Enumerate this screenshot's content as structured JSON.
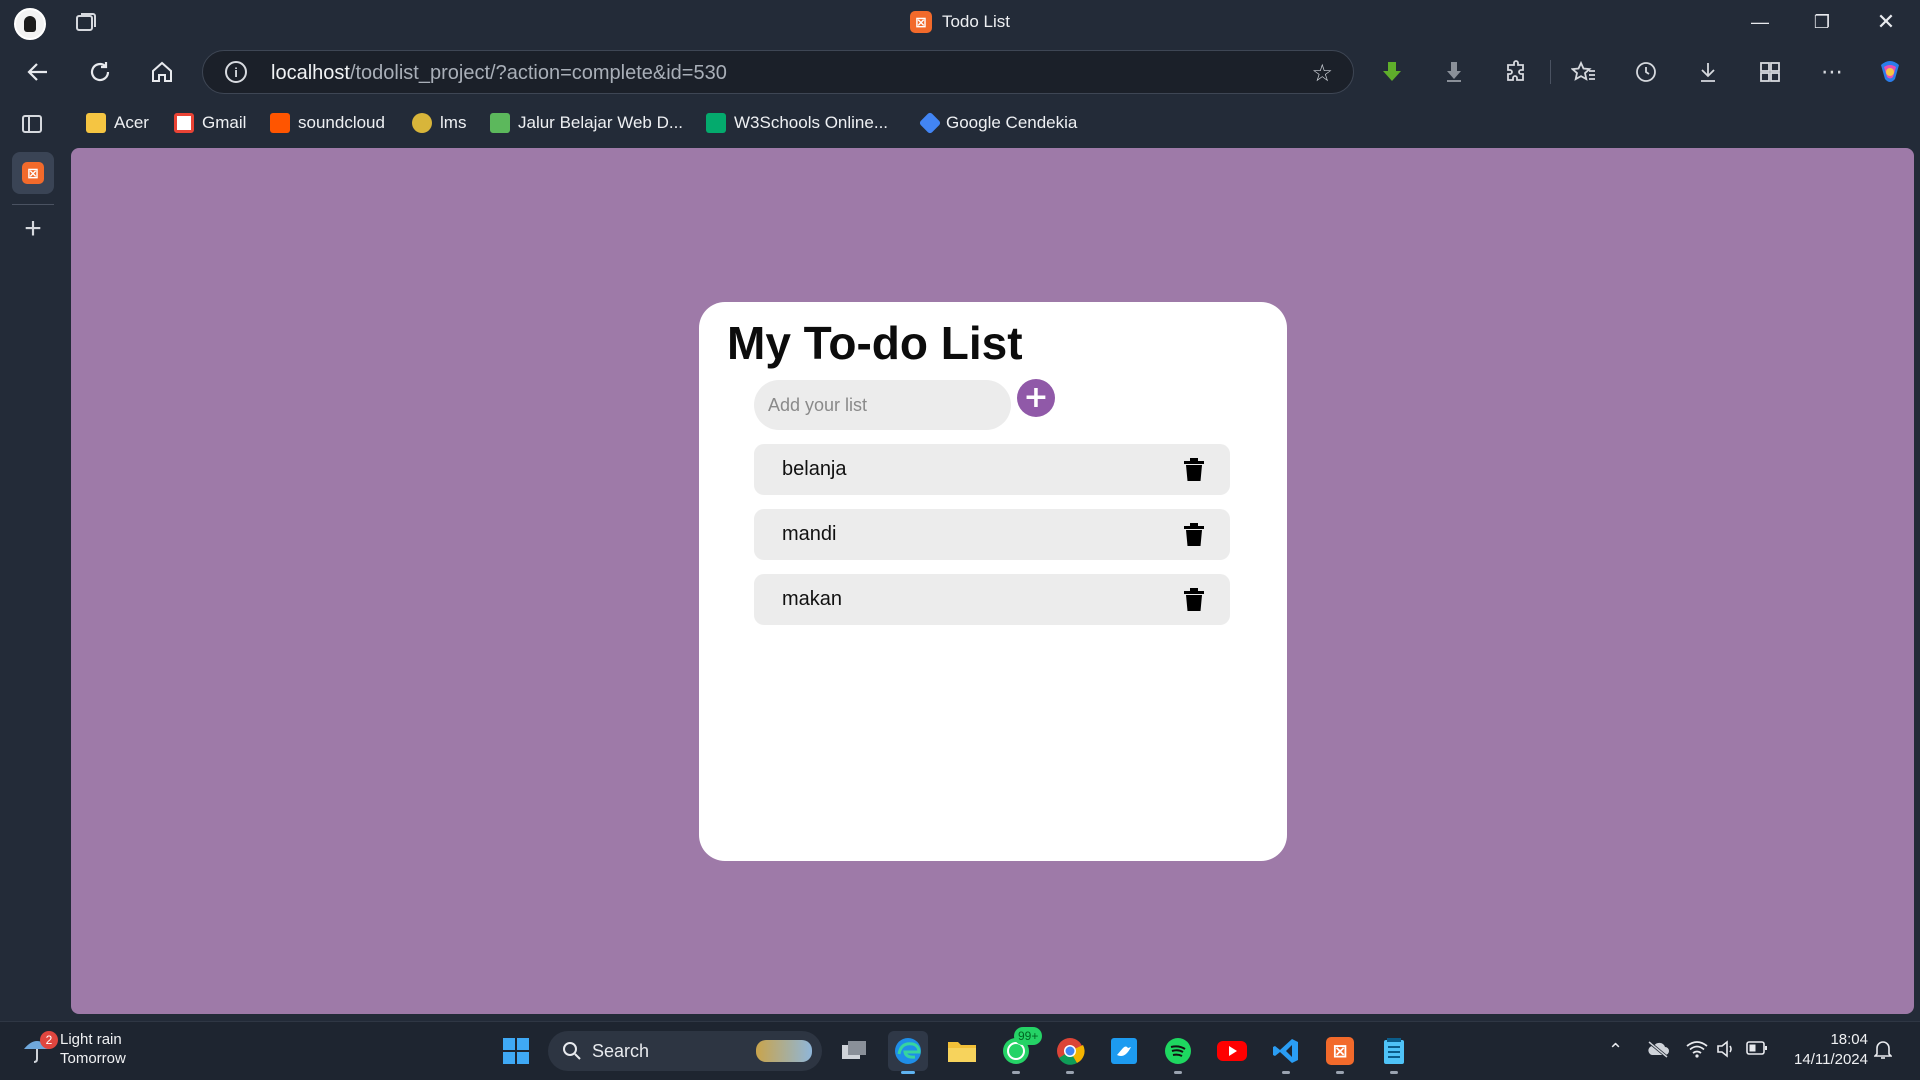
{
  "window": {
    "title": "Todo List"
  },
  "address": {
    "host": "localhost",
    "path": "/todolist_project/?action=complete&id=530"
  },
  "bookmarks": [
    {
      "label": "Acer",
      "icon": "folder-icon",
      "color": "#f5c542"
    },
    {
      "label": "Gmail",
      "icon": "gmail-icon",
      "color": "#ea4335"
    },
    {
      "label": "soundcloud",
      "icon": "soundcloud-icon",
      "color": "#ff5500"
    },
    {
      "label": "lms",
      "icon": "lms-icon",
      "color": "#d8b53a"
    },
    {
      "label": "Jalur Belajar Web D...",
      "icon": "web-icon",
      "color": "#5cb85c"
    },
    {
      "label": "W3Schools Online...",
      "icon": "w3schools-icon",
      "color": "#04aa6d"
    },
    {
      "label": "Google Cendekia",
      "icon": "scholar-icon",
      "color": "#4285f4"
    }
  ],
  "app": {
    "title": "My To-do List",
    "input_placeholder": "Add your list",
    "add_button": "+",
    "accent": "#9059a8",
    "background": "#9e7aa8",
    "items": [
      {
        "label": "belanja"
      },
      {
        "label": "mandi"
      },
      {
        "label": "makan"
      }
    ]
  },
  "taskbar": {
    "weather": {
      "line1": "Light rain",
      "line2": "Tomorrow",
      "badge": "2"
    },
    "search_label": "Search",
    "whatsapp_badge": "99+",
    "time": "18:04",
    "date": "14/11/2024"
  }
}
